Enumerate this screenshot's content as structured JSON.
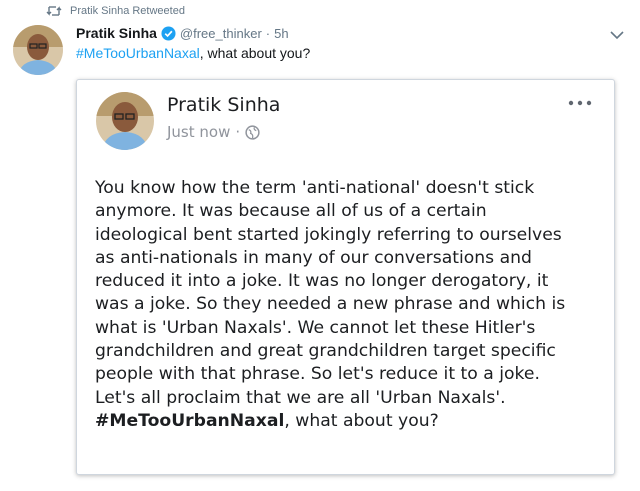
{
  "retweet": {
    "label": "Pratik Sinha Retweeted",
    "icon": "retweet-icon"
  },
  "tweet": {
    "author_name": "Pratik Sinha",
    "verified_icon": "verified-badge-icon",
    "handle": "@free_thinker",
    "separator": "·",
    "time": "5h",
    "hashtag": "#MeTooUrbanNaxal",
    "text_rest": ", what about you?",
    "menu_icon": "chevron-down-icon",
    "link_color": "#1da1f2"
  },
  "embedded_post": {
    "author_name": "Pratik Sinha",
    "timestamp": "Just now",
    "separator": "·",
    "privacy_icon": "globe-icon",
    "more_icon": "more-options-icon",
    "body_lines": [
      "You know how the term 'anti-national' doesn't stick",
      "anymore. It was because all of us of a certain",
      "ideological bent started jokingly referring to ourselves",
      "as anti-nationals in many of our conversations and",
      "reduced it into a joke. It was no longer derogatory, it",
      "was a joke. So they needed a new phrase and which is",
      "what is 'Urban Naxals'. We cannot let these Hitler's",
      "grandchildren and great grandchildren target specific",
      "people with that phrase. So let's reduce it to a joke.",
      "Let's all proclaim that we are all 'Urban Naxals'."
    ],
    "last_line_hashtag": "#MeTooUrbanNaxal",
    "last_line_rest": ", what about you?"
  }
}
